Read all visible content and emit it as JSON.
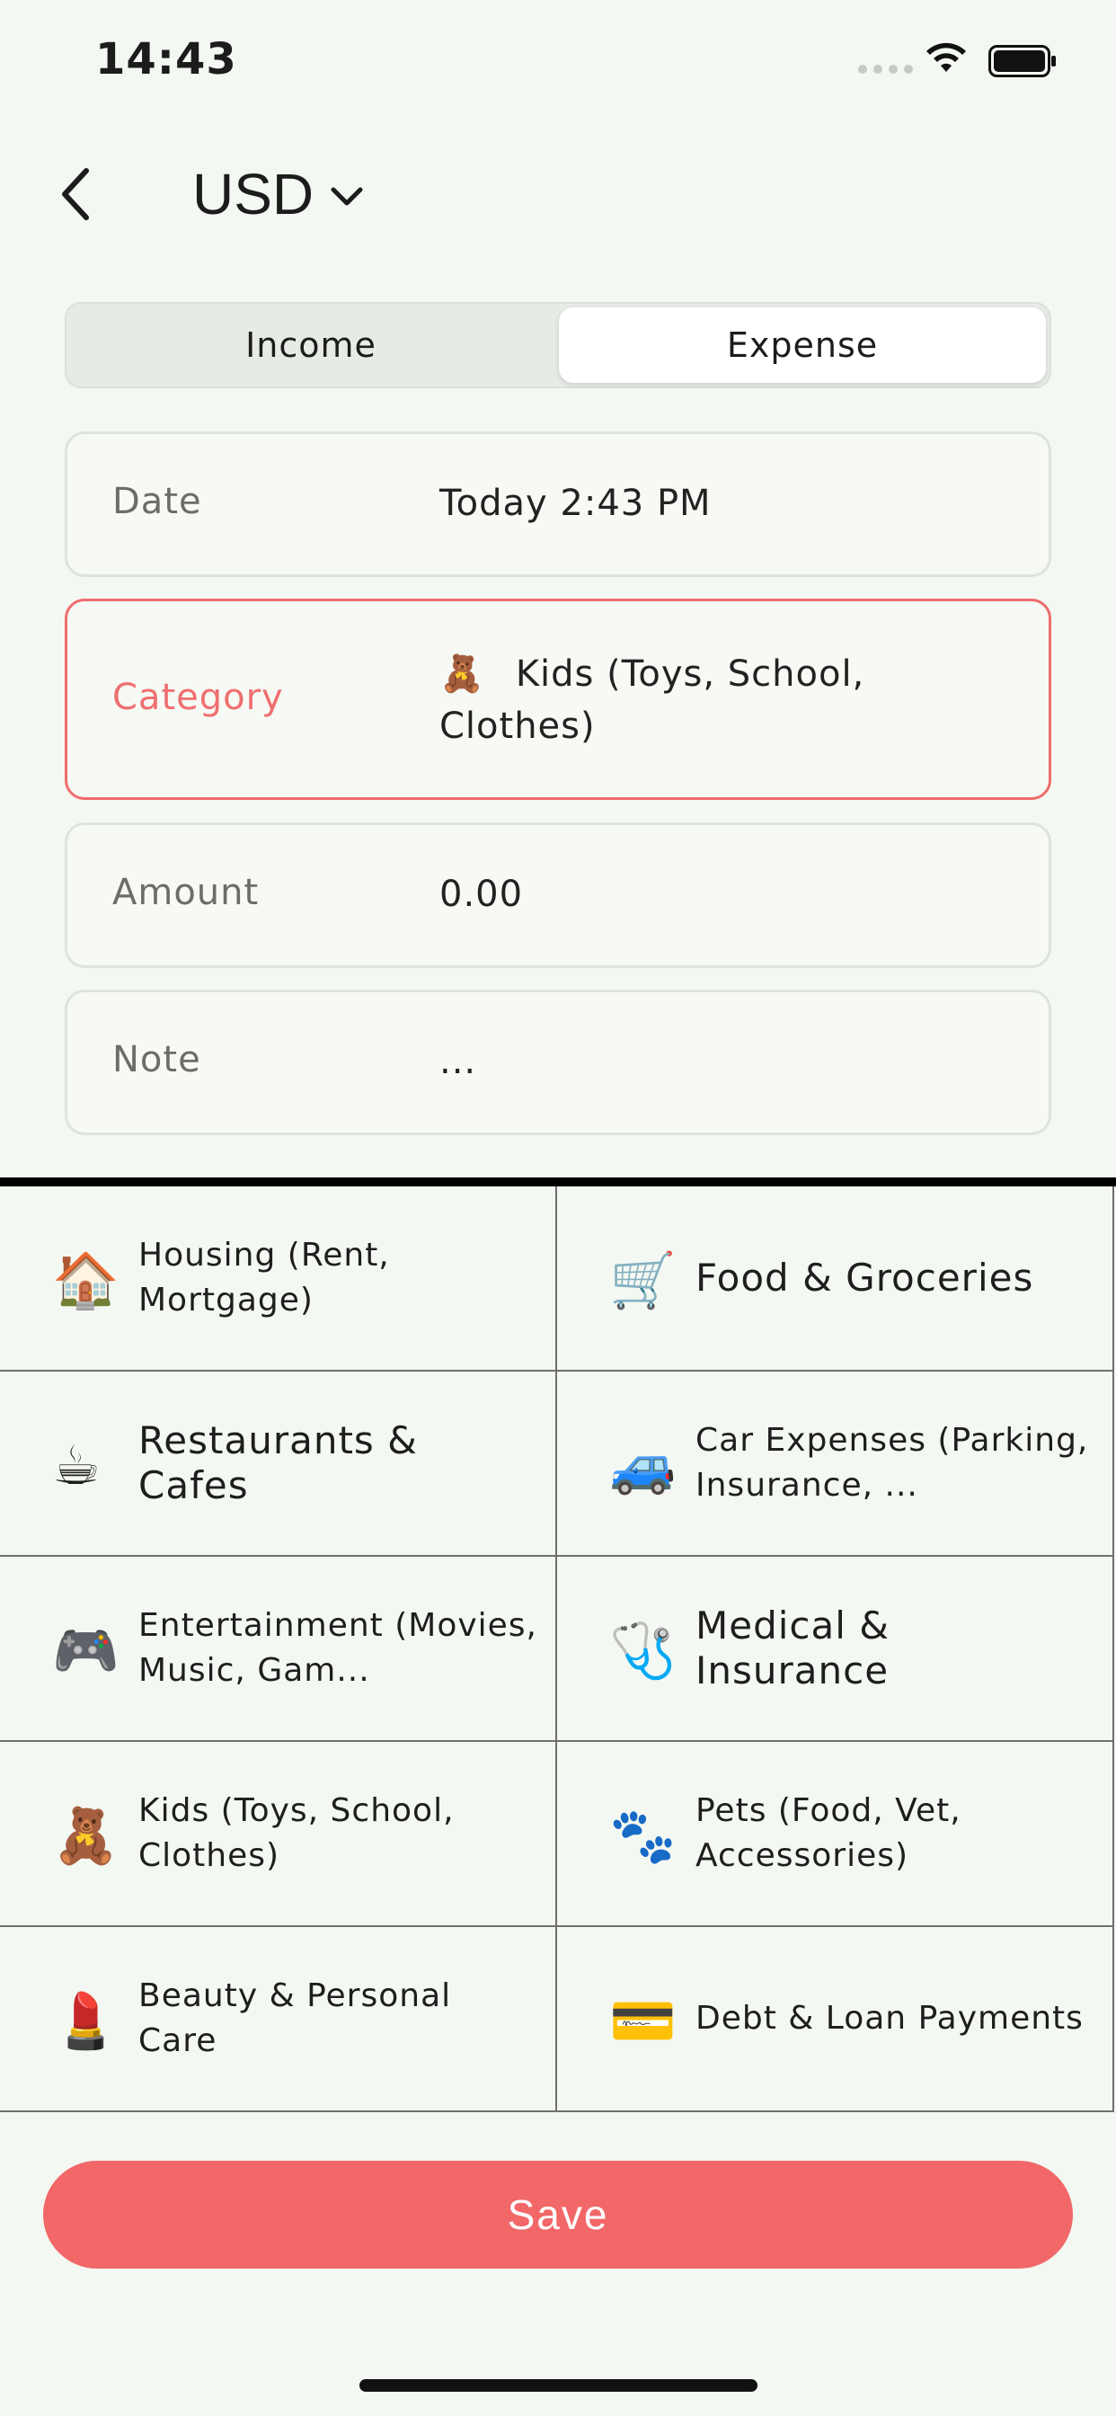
{
  "status_bar": {
    "time": "14:43"
  },
  "header": {
    "currency": "USD"
  },
  "tabs": [
    {
      "label": "Income",
      "selected": false
    },
    {
      "label": "Expense",
      "selected": true
    }
  ],
  "form": {
    "date": {
      "label": "Date",
      "value": "Today 2:43 PM"
    },
    "category": {
      "label": "Category",
      "emoji": "🧸",
      "value": "Kids (Toys, School, Clothes)"
    },
    "amount": {
      "label": "Amount",
      "value": "0.00"
    },
    "note": {
      "label": "Note",
      "value": "..."
    }
  },
  "categories": [
    {
      "emoji": "🏠",
      "label": "Housing (Rent, Mortgage)"
    },
    {
      "emoji": "🛒",
      "label": "Food & Groceries"
    },
    {
      "emoji": "☕",
      "label": "Restaurants & Cafes"
    },
    {
      "emoji": "🚙",
      "label": "Car Expenses (Parking, Insurance, ..."
    },
    {
      "emoji": "🎮",
      "label": "Entertainment (Movies, Music, Gam..."
    },
    {
      "emoji": "🩺",
      "label": "Medical & Insurance"
    },
    {
      "emoji": "🧸",
      "label": "Kids (Toys, School, Clothes)"
    },
    {
      "emoji": "🐾",
      "label": "Pets (Food, Vet, Accessories)"
    },
    {
      "emoji": "💄",
      "label": "Beauty & Personal Care"
    },
    {
      "emoji": "💳",
      "label": "Debt & Loan Payments"
    }
  ],
  "actions": {
    "save": "Save"
  },
  "colors": {
    "accent": "#f26768",
    "background": "#f4f8f2",
    "active_border": "#ef6d6d"
  }
}
